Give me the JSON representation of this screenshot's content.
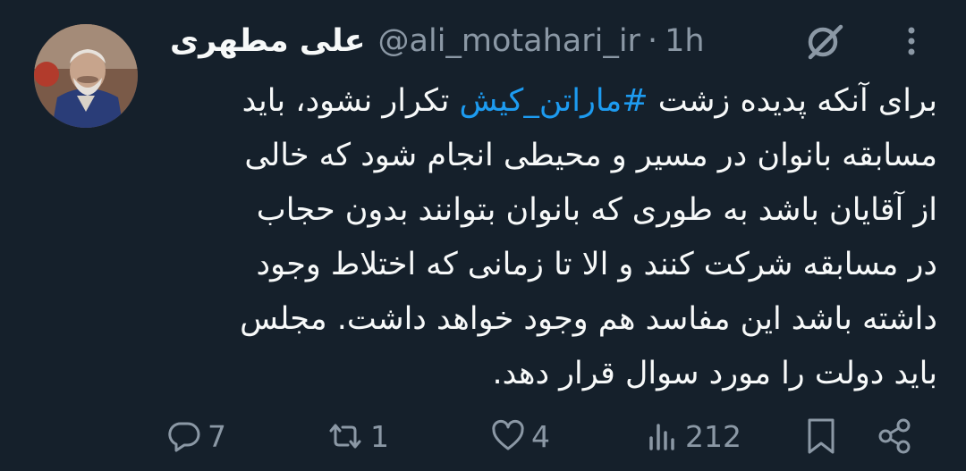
{
  "tweet": {
    "display_name": "علی مطهری",
    "handle": "@ali_motahari_ir",
    "separator": "·",
    "time": "1h",
    "text_before_hashtag": "برای آنکه پدیده زشت ",
    "hashtag": "#ماراتن_کیش",
    "text_after_hashtag": " تکرار نشود، باید",
    "lines": [
      "مسابقه بانوان در مسیر و محیطی انجام شود که خالی",
      "از آقایان باشد به طوری که بانوان بتوانند بدون حجاب",
      "در مسابقه شرکت کنند و الا تا زمانی که اختلاط وجود",
      "داشته باشد این مفاسد هم وجود خواهد داشت. مجلس",
      "باید دولت را مورد سوال قرار دهد."
    ]
  },
  "actions": {
    "replies": "7",
    "retweets": "1",
    "likes": "4",
    "views": "212"
  },
  "icons": {
    "reply": "reply-icon",
    "retweet": "retweet-icon",
    "like": "heart-icon",
    "views": "views-icon",
    "bookmark": "bookmark-icon",
    "share": "share-icon",
    "grok": "grok-icon",
    "more": "more-icon"
  },
  "colors": {
    "background": "#15202b",
    "text": "#f7f9f9",
    "muted": "#8b98a5",
    "link": "#1d9bf0"
  }
}
